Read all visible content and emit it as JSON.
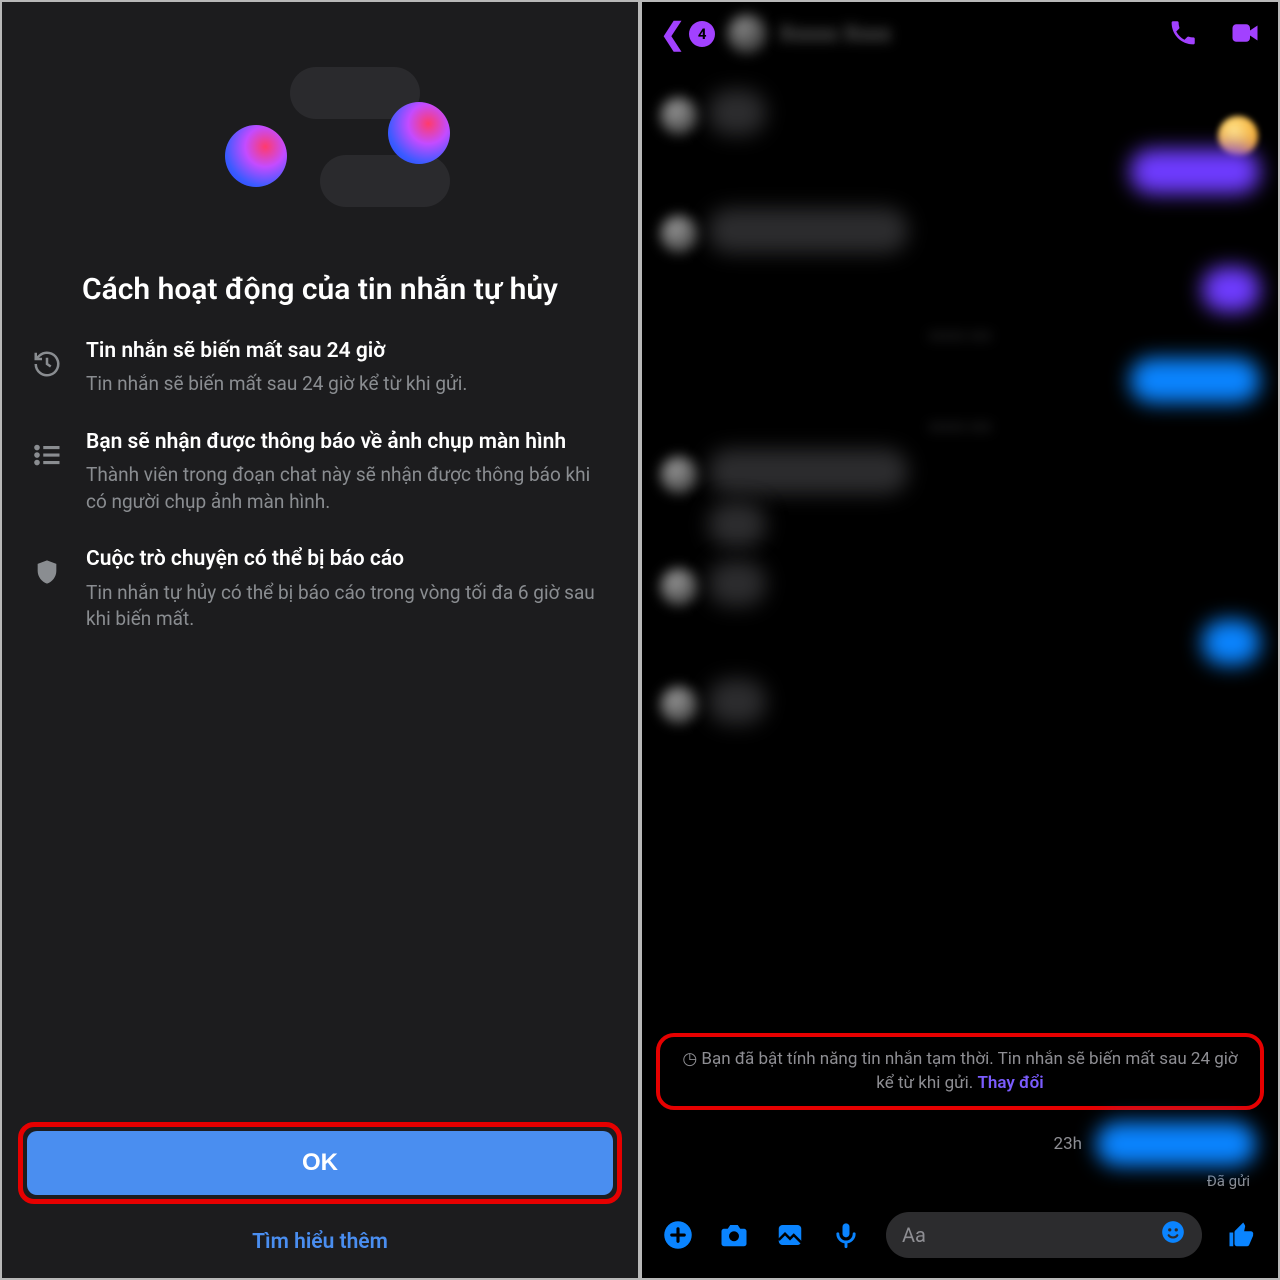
{
  "left": {
    "title": "Cách hoạt động của tin nhắn tự hủy",
    "features": [
      {
        "icon": "history",
        "title": "Tin nhắn sẽ biến mất sau 24 giờ",
        "desc": "Tin nhắn sẽ biến mất sau 24 giờ kể từ khi gửi."
      },
      {
        "icon": "list",
        "title": "Bạn sẽ nhận được thông báo về ảnh chụp màn hình",
        "desc": "Thành viên trong đoạn chat này sẽ nhận được thông báo khi có người chụp ảnh màn hình."
      },
      {
        "icon": "shield",
        "title": "Cuộc trò chuyện có thể bị báo cáo",
        "desc": "Tin nhắn tự hủy có thể bị báo cáo trong vòng tối đa 6 giờ sau khi biến mất."
      }
    ],
    "ok": "OK",
    "learn_more": "Tìm hiểu thêm"
  },
  "right": {
    "back_badge": "4",
    "notice_prefix": "Bạn đã bật tính năng tin nhắn tạm thời. Tin nhắn sẽ biến mất sau 24 giờ kể từ khi gửi. ",
    "notice_link": "Thay đổi",
    "last_time": "23h",
    "delivered": "Đã gửi",
    "input_placeholder": "Aa"
  }
}
